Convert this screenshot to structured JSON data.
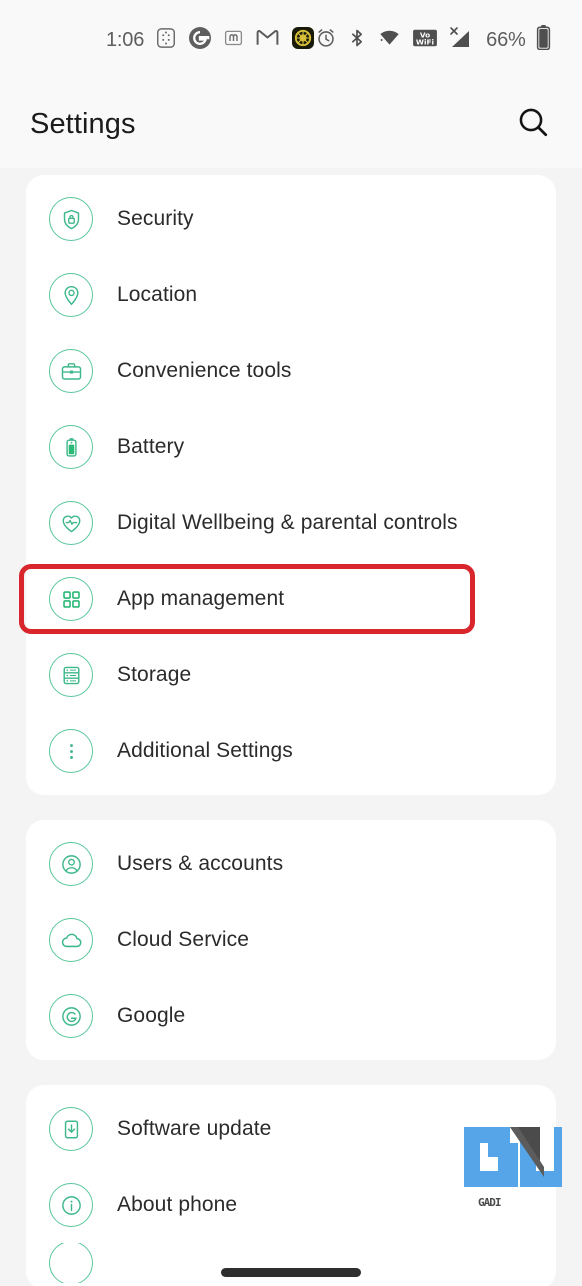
{
  "status_bar": {
    "clock": "1:06",
    "battery_percent": "66%",
    "left_icons": [
      "keypad-icon",
      "google-g-icon",
      "mastodon-icon",
      "gmail-icon",
      "app-badge-icon"
    ],
    "right_icons": [
      "alarm-icon",
      "bluetooth-icon",
      "wifi-icon",
      "volte-wifi-icon",
      "signal-icon",
      "battery-icon"
    ]
  },
  "header": {
    "title": "Settings",
    "search_icon": "search-icon"
  },
  "groups": [
    {
      "items": [
        {
          "label": "Security",
          "icon": "shield-lock-icon"
        },
        {
          "label": "Location",
          "icon": "location-pin-icon"
        },
        {
          "label": "Convenience tools",
          "icon": "toolbox-icon"
        },
        {
          "label": "Battery",
          "icon": "battery-icon"
        },
        {
          "label": "Digital Wellbeing & parental controls",
          "icon": "heart-icon"
        },
        {
          "label": "App management",
          "icon": "grid-apps-icon",
          "highlighted": true
        },
        {
          "label": "Storage",
          "icon": "storage-icon"
        },
        {
          "label": "Additional Settings",
          "icon": "more-vertical-icon"
        }
      ]
    },
    {
      "items": [
        {
          "label": "Users & accounts",
          "icon": "user-account-icon"
        },
        {
          "label": "Cloud Service",
          "icon": "cloud-icon"
        },
        {
          "label": "Google",
          "icon": "google-g-icon"
        }
      ]
    },
    {
      "items": [
        {
          "label": "Software update",
          "icon": "software-update-icon"
        },
        {
          "label": "About phone",
          "icon": "info-icon"
        }
      ]
    }
  ],
  "watermark": {
    "text": "GADI"
  },
  "colors": {
    "accent_green": "#58c79a",
    "highlight_red": "#d8262c",
    "page_background": "#f3f4f3",
    "card_background": "#ffffff",
    "label_text": "#2b2b2b",
    "watermark_blue": "#56a5e8"
  }
}
